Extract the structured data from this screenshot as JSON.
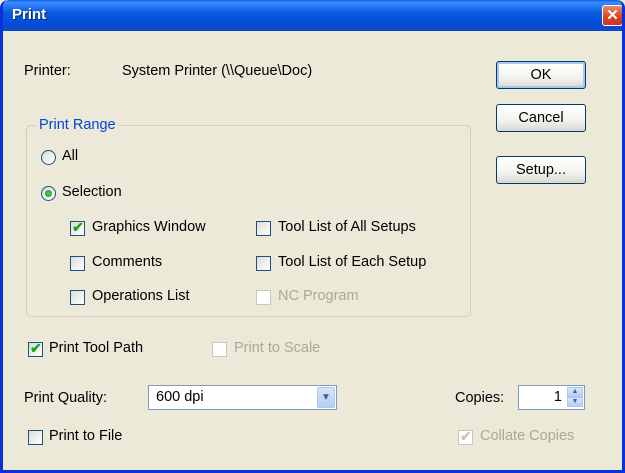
{
  "window": {
    "title": "Print",
    "close_glyph": "✕"
  },
  "printer": {
    "label": "Printer:",
    "value": "System Printer (\\\\Queue\\Doc)"
  },
  "buttons": {
    "ok": "OK",
    "cancel": "Cancel",
    "setup": "Setup..."
  },
  "print_range": {
    "legend": "Print Range",
    "all_label": "All",
    "selection_label": "Selection",
    "selected": "Selection",
    "graphics_window": {
      "label": "Graphics Window",
      "checked": true
    },
    "comments": {
      "label": "Comments",
      "checked": false
    },
    "operations_list": {
      "label": "Operations List",
      "checked": false
    },
    "tool_list_all": {
      "label": "Tool List of All Setups",
      "checked": false
    },
    "tool_list_each": {
      "label": "Tool List of Each Setup",
      "checked": false
    },
    "nc_program": {
      "label": "NC Program",
      "checked": false,
      "enabled": false
    }
  },
  "print_tool_path": {
    "label": "Print Tool Path",
    "checked": true
  },
  "print_to_scale": {
    "label": "Print to Scale",
    "checked": false,
    "enabled": false
  },
  "print_quality": {
    "label": "Print Quality:",
    "value": "600 dpi"
  },
  "copies": {
    "label": "Copies:",
    "value": "1"
  },
  "print_to_file": {
    "label": "Print to File",
    "checked": false
  },
  "collate_copies": {
    "label": "Collate Copies",
    "checked": true,
    "enabled": false
  },
  "glyphs": {
    "check": "✔",
    "dropdown": "▼",
    "up": "▲",
    "down": "▼"
  }
}
